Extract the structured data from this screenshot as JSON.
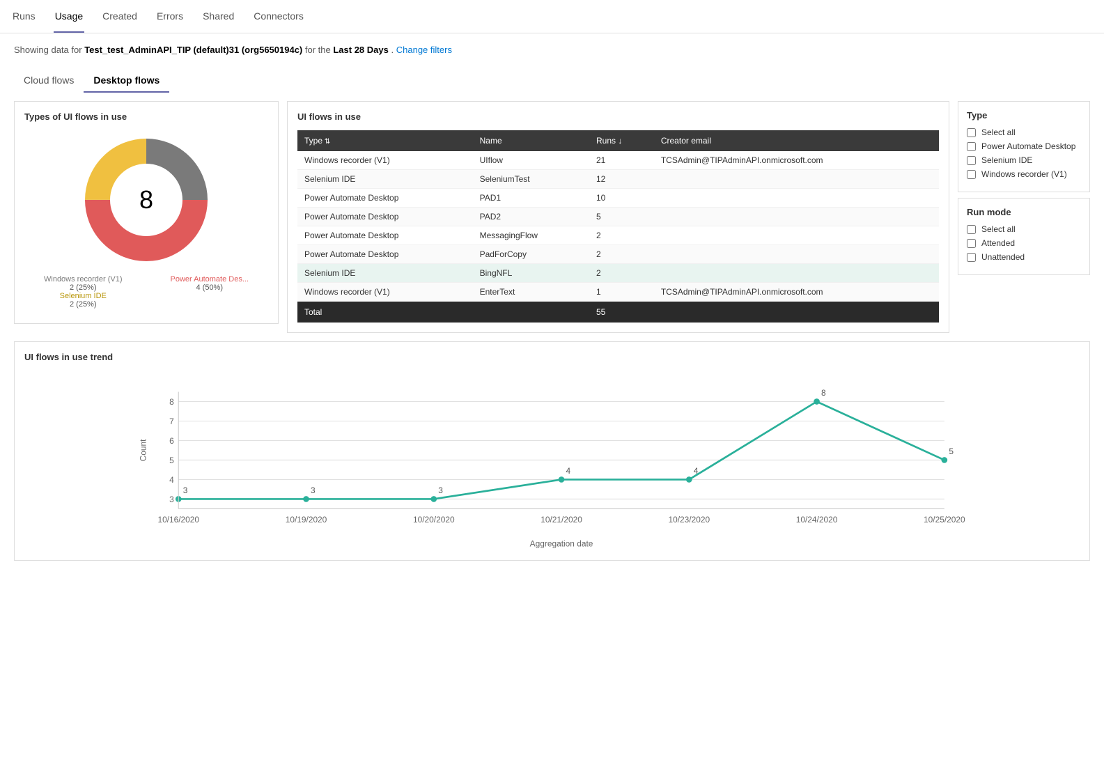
{
  "nav": {
    "items": [
      {
        "label": "Runs",
        "active": false
      },
      {
        "label": "Usage",
        "active": true
      },
      {
        "label": "Created",
        "active": false
      },
      {
        "label": "Errors",
        "active": false
      },
      {
        "label": "Shared",
        "active": false
      },
      {
        "label": "Connectors",
        "active": false
      }
    ]
  },
  "subtitle": {
    "prefix": "Showing data for ",
    "org": "Test_test_AdminAPI_TIP (default)31 (org5650194c)",
    "middle": " for the ",
    "period": "Last 28 Days",
    "suffix": ".",
    "change_filters": "Change filters"
  },
  "flow_tabs": [
    {
      "label": "Cloud flows",
      "active": false
    },
    {
      "label": "Desktop flows",
      "active": true
    }
  ],
  "donut": {
    "title": "Types of UI flows in use",
    "center_value": "8",
    "segments": [
      {
        "label": "Windows recorder (V1)",
        "pct": 25,
        "value": 2,
        "color": "#7a7a7a"
      },
      {
        "label": "Power Automate Des...",
        "pct": 50,
        "value": 4,
        "color": "#e05a5a"
      },
      {
        "label": "Selenium IDE",
        "pct": 25,
        "value": 2,
        "color": "#f0c040"
      }
    ]
  },
  "ui_flows_table": {
    "title": "UI flows in use",
    "columns": [
      "Type",
      "Name",
      "Runs",
      "Creator email"
    ],
    "rows": [
      {
        "type": "Windows recorder (V1)",
        "name": "UIflow",
        "runs": 21,
        "email": "TCSAdmin@TIPAdminAPI.onmicrosoft.com",
        "highlighted": false
      },
      {
        "type": "Selenium IDE",
        "name": "SeleniumTest",
        "runs": 12,
        "email": "",
        "highlighted": false
      },
      {
        "type": "Power Automate Desktop",
        "name": "PAD1",
        "runs": 10,
        "email": "",
        "highlighted": false
      },
      {
        "type": "Power Automate Desktop",
        "name": "PAD2",
        "runs": 5,
        "email": "",
        "highlighted": false
      },
      {
        "type": "Power Automate Desktop",
        "name": "MessagingFlow",
        "runs": 2,
        "email": "",
        "highlighted": false
      },
      {
        "type": "Power Automate Desktop",
        "name": "PadForCopy",
        "runs": 2,
        "email": "",
        "highlighted": false
      },
      {
        "type": "Selenium IDE",
        "name": "BingNFL",
        "runs": 2,
        "email": "",
        "highlighted": true
      },
      {
        "type": "Windows recorder (V1)",
        "name": "EnterText",
        "runs": 1,
        "email": "TCSAdmin@TIPAdminAPI.onmicrosoft.com",
        "highlighted": false
      }
    ],
    "total_label": "Total",
    "total_value": 55
  },
  "type_filter": {
    "title": "Type",
    "items": [
      {
        "label": "Select all",
        "checked": false
      },
      {
        "label": "Power Automate Desktop",
        "checked": false
      },
      {
        "label": "Selenium IDE",
        "checked": false
      },
      {
        "label": "Windows recorder (V1)",
        "checked": false
      }
    ]
  },
  "run_mode_filter": {
    "title": "Run mode",
    "items": [
      {
        "label": "Select all",
        "checked": false
      },
      {
        "label": "Attended",
        "checked": false
      },
      {
        "label": "Unattended",
        "checked": false
      }
    ]
  },
  "trend": {
    "title": "UI flows in use trend",
    "y_label": "Count",
    "x_label": "Aggregation date",
    "y_ticks": [
      3,
      4,
      5,
      6,
      7,
      8
    ],
    "data_points": [
      {
        "date": "10/16/2020",
        "value": 3
      },
      {
        "date": "10/19/2020",
        "value": 3
      },
      {
        "date": "10/20/2020",
        "value": 3
      },
      {
        "date": "10/21/2020",
        "value": 4
      },
      {
        "date": "10/23/2020",
        "value": 4
      },
      {
        "date": "10/24/2020",
        "value": 8
      },
      {
        "date": "10/25/2020",
        "value": 5
      }
    ],
    "line_color": "#2ab09a"
  }
}
